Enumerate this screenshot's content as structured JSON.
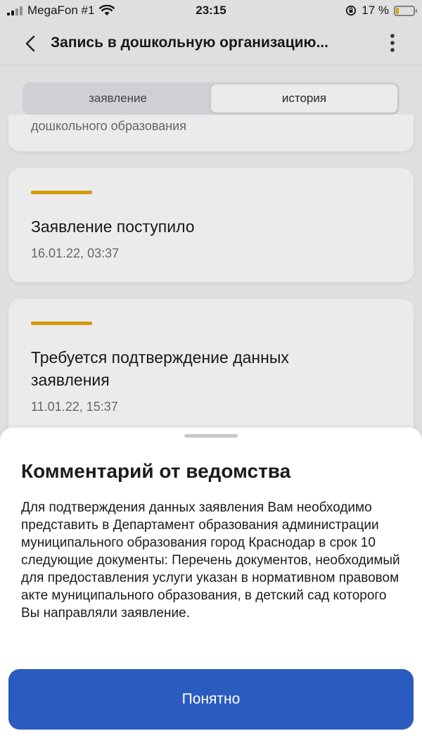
{
  "status_bar": {
    "carrier": "MegaFon #1",
    "time": "23:15",
    "battery_percent_label": "17 %",
    "battery_level": 0.17
  },
  "header": {
    "title": "Запись в дошкольную организацию..."
  },
  "tabs": [
    {
      "label": "заявление",
      "active": false
    },
    {
      "label": "история",
      "active": true
    }
  ],
  "history": {
    "partial_card_text": "дошкольного образования",
    "items": [
      {
        "title": "Заявление поступило",
        "date": "16.01.22, 03:37"
      },
      {
        "title": "Требуется подтверждение данных заявления",
        "date": "11.01.22, 15:37"
      }
    ]
  },
  "sheet": {
    "title": "Комментарий от ведомства",
    "text": "Для подтверждения данных заявления Вам необходимо представить в Департамент образования администрации муниципального образования город Краснодар в срок 10 следующие документы: Перечень документов, необходимый для предоставления услуги указан в нормативном правовом акте муниципального образования, в детский сад которого Вы направляли заявление.",
    "button_label": "Понятно"
  },
  "colors": {
    "accent": "#e8a80d",
    "primary_button": "#2a5bbf"
  }
}
